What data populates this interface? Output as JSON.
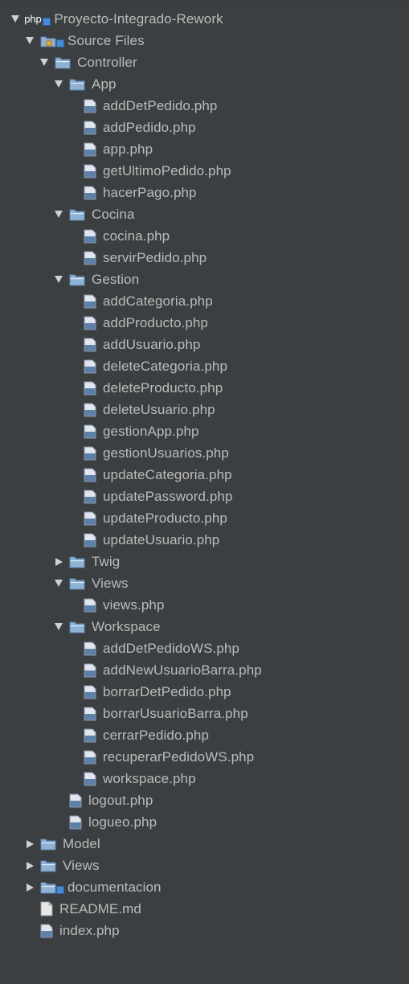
{
  "project": {
    "logo_text": "php",
    "name": "Proyecto-Integrado-Rework"
  },
  "colors": {
    "background": "#3c3f41",
    "text": "#bbbbbb",
    "folder": "#8eb1d6",
    "php_file": "#5e7fa8"
  },
  "tree": {
    "source_files": "Source Files",
    "controller": "Controller",
    "app": "App",
    "app_files": [
      "addDetPedido.php",
      "addPedido.php",
      "app.php",
      "getUltimoPedido.php",
      "hacerPago.php"
    ],
    "cocina": "Cocina",
    "cocina_files": [
      "cocina.php",
      "servirPedido.php"
    ],
    "gestion": "Gestion",
    "gestion_files": [
      "addCategoria.php",
      "addProducto.php",
      "addUsuario.php",
      "deleteCategoria.php",
      "deleteProducto.php",
      "deleteUsuario.php",
      "gestionApp.php",
      "gestionUsuarios.php",
      "updateCategoria.php",
      "updatePassword.php",
      "updateProducto.php",
      "updateUsuario.php"
    ],
    "twig": "Twig",
    "views_sub": "Views",
    "views_files": [
      "views.php"
    ],
    "workspace": "Workspace",
    "workspace_files": [
      "addDetPedidoWS.php",
      "addNewUsuarioBarra.php",
      "borrarDetPedido.php",
      "borrarUsuarioBarra.php",
      "cerrarPedido.php",
      "recuperarPedidoWS.php",
      "workspace.php"
    ],
    "controller_files": [
      "logout.php",
      "logueo.php"
    ],
    "model": "Model",
    "views": "Views",
    "documentacion": "documentacion",
    "readme": "README.md",
    "index": "index.php"
  }
}
